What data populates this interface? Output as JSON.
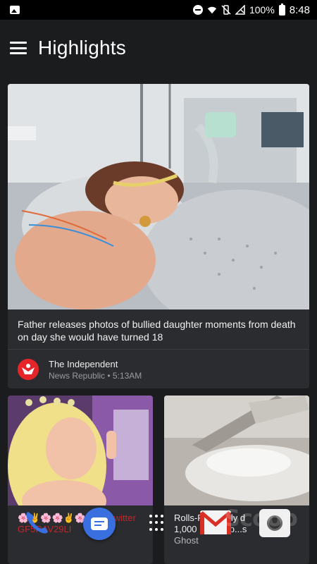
{
  "status_bar": {
    "left_icon": "gallery-icon",
    "icons": [
      "do-not-disturb-icon",
      "wifi-icon",
      "vibrate-off-icon",
      "no-signal-icon",
      "battery-icon"
    ],
    "battery": "100%",
    "time": "8:48"
  },
  "header": {
    "title": "Highlights",
    "menu_icon": "menu-icon"
  },
  "feed": {
    "main_card": {
      "headline": "Father releases photos of bullied daughter moments from death on day she would have turned 18",
      "source_name": "The Independent",
      "source_meta": "News Republic • 5:13AM"
    },
    "card_2": {
      "text_line1": "🌸✌🌸🌸✌🌸✌🌸",
      "text_line1b": "twitter",
      "text_line2": "GF5RAV29LI"
    },
    "card_3": {
      "text_line1": "Rolls-R...ctually d",
      "text_line2": "1,000 ...ds to p...s",
      "text_line3": "Ghost"
    }
  },
  "dock": {
    "apps": [
      "phone-icon",
      "messages-icon",
      "apps-drawer-icon",
      "gmail-icon",
      "camera-icon"
    ]
  },
  "watermark": "Scoop",
  "colors": {
    "background": "#1b1c1e",
    "card": "#2b2c2f",
    "accent_red": "#e5252a",
    "messages_blue": "#3a6fe0"
  }
}
